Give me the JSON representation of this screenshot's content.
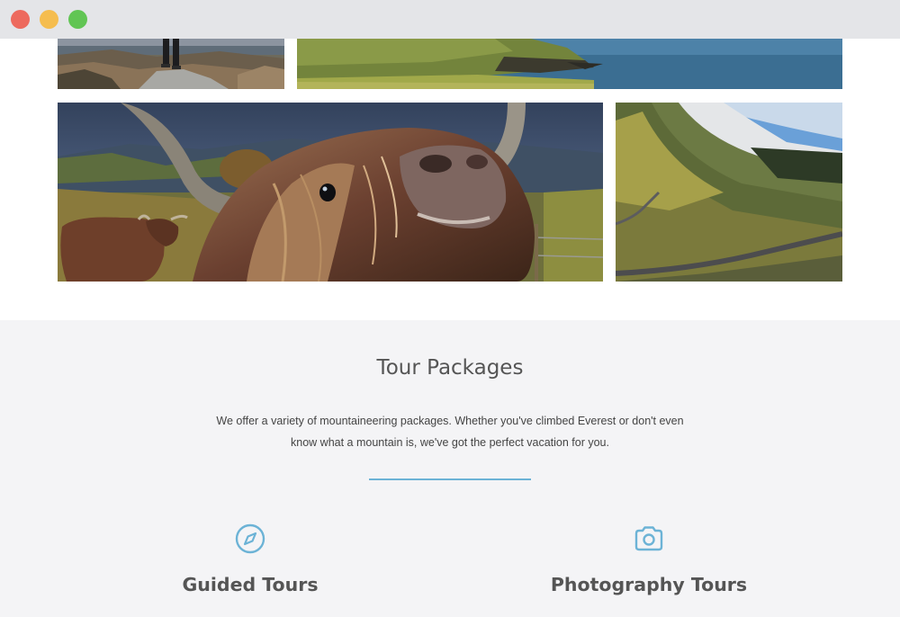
{
  "window": {
    "controls": [
      "close",
      "minimize",
      "zoom"
    ]
  },
  "gallery": {
    "photos": [
      {
        "id": "top-left",
        "subject": "hiker-on-rocks-by-lake"
      },
      {
        "id": "top-right",
        "subject": "green-headland-and-sea"
      },
      {
        "id": "cow",
        "subject": "highland-cow-closeup"
      },
      {
        "id": "valley",
        "subject": "mountain-valley-road"
      }
    ]
  },
  "packages": {
    "title": "Tour Packages",
    "description": "We offer a variety of mountaineering packages. Whether you've climbed Everest or don't even know what a mountain is, we've got the perfect vacation for you.",
    "accent_color": "#6cb3d6",
    "features": [
      {
        "name": "Guided Tours",
        "icon": "compass-icon"
      },
      {
        "name": "Photography Tours",
        "icon": "camera-icon"
      }
    ]
  }
}
